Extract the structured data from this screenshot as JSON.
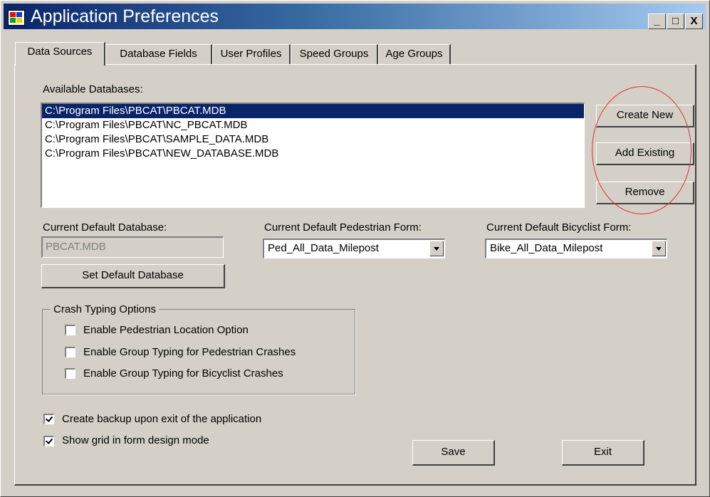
{
  "window": {
    "title": "Application Preferences",
    "minimize_label": "_",
    "maximize_label": "□",
    "close_label": "X"
  },
  "tabs": [
    {
      "label": "Data Sources",
      "active": true
    },
    {
      "label": "Database Fields",
      "active": false
    },
    {
      "label": "User Profiles",
      "active": false
    },
    {
      "label": "Speed Groups",
      "active": false
    },
    {
      "label": "Age Groups",
      "active": false
    }
  ],
  "available_databases": {
    "label": "Available Databases:",
    "items": [
      "C:\\Program Files\\PBCAT\\PBCAT.MDB",
      "C:\\Program Files\\PBCAT\\NC_PBCAT.MDB",
      "C:\\Program Files\\PBCAT\\SAMPLE_DATA.MDB",
      "C:\\Program Files\\PBCAT\\NEW_DATABASE.MDB"
    ],
    "selected_index": 0
  },
  "db_buttons": {
    "create_new": "Create New",
    "add_existing": "Add Existing",
    "remove": "Remove"
  },
  "default_database": {
    "label": "Current Default Database:",
    "value": "PBCAT.MDB",
    "set_button": "Set Default Database"
  },
  "pedestrian_form": {
    "label": "Current Default Pedestrian Form:",
    "value": "Ped_All_Data_Milepost"
  },
  "bicyclist_form": {
    "label": "Current Default Bicyclist Form:",
    "value": "Bike_All_Data_Milepost"
  },
  "crash_typing": {
    "legend": "Crash Typing Options",
    "options": [
      {
        "label": "Enable Pedestrian Location Option",
        "checked": false
      },
      {
        "label": "Enable Group Typing for Pedestrian Crashes",
        "checked": false
      },
      {
        "label": "Enable Group Typing for Bicyclist Crashes",
        "checked": false
      }
    ]
  },
  "general_options": [
    {
      "label": "Create backup upon exit of the application",
      "checked": true
    },
    {
      "label": "Show grid in form design mode",
      "checked": true
    }
  ],
  "footer": {
    "save": "Save",
    "exit": "Exit"
  },
  "colors": {
    "selection": "#0a246a",
    "annotation_circle": "#e03030",
    "face": "#d4d0c8"
  }
}
